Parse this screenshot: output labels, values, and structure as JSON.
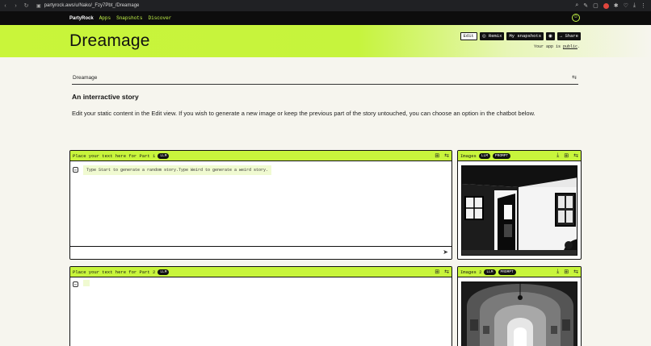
{
  "browser": {
    "url": "partyrock.aws/u/Nako/_Fzy7Pbt_/Dreamage",
    "nav": {
      "back": "‹",
      "forward": "›",
      "reload": "↻"
    }
  },
  "app_nav": {
    "brand": "PartyRock",
    "links": [
      "Apps",
      "Snapshots",
      "Discover"
    ]
  },
  "hero": {
    "title": "Dreamage",
    "buttons": {
      "edit": "Edit",
      "remix": "Remix",
      "snapshots": "My snapshots",
      "share": "Share"
    },
    "public_note_prefix": "Your app is ",
    "public_note_link": "public",
    "public_note_suffix": "."
  },
  "description": {
    "name": "Dreamage",
    "title": "An interractive story",
    "text": "Edit your static content in the Edit view. If you wish to generate a new image or keep the previous part of the story untouched, you can choose an option in the chatbot below."
  },
  "widgets": {
    "part1": {
      "title": "Place your text here for Part 1",
      "badge": "LLM",
      "message": "Type Start to generate a random story.Type Weird to generate a weird story."
    },
    "images1": {
      "title": "Images",
      "badges": [
        "LLM",
        "PROMPT"
      ]
    },
    "part2": {
      "title": "Place your text here for Part 2",
      "badge": "LLM"
    },
    "images2": {
      "title": "Images 2",
      "badges": [
        "LLM",
        "PROMPT"
      ]
    }
  },
  "colors": {
    "accent": "#c8f53c",
    "dark": "#111111",
    "page": "#f6f5ee"
  },
  "icons": {
    "sliders": "⇆",
    "download": "⤓",
    "add": "⊞",
    "send": "➤",
    "camera": "◉",
    "share_arrow": "→",
    "smile": "☺"
  }
}
